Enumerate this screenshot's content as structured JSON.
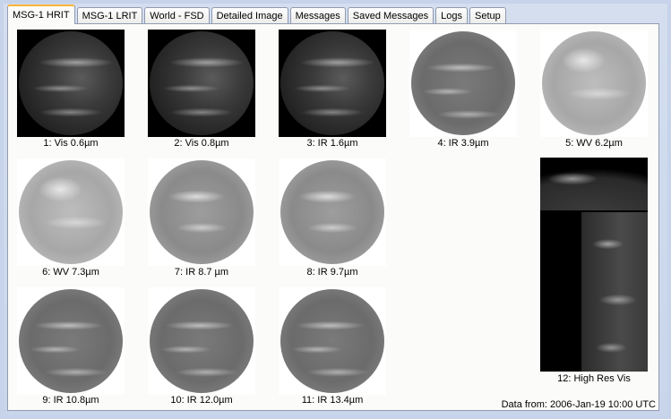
{
  "tabs": [
    {
      "label": "MSG-1 HRIT",
      "active": true
    },
    {
      "label": "MSG-1 LRIT"
    },
    {
      "label": "World - FSD"
    },
    {
      "label": "Detailed Image"
    },
    {
      "label": "Messages"
    },
    {
      "label": "Saved Messages"
    },
    {
      "label": "Logs"
    },
    {
      "label": "Setup"
    }
  ],
  "images": [
    {
      "label": "1:  Vis 0.6µm"
    },
    {
      "label": "2:  Vis 0.8µm"
    },
    {
      "label": "3:  IR 1.6µm"
    },
    {
      "label": "4:  IR 3.9µm"
    },
    {
      "label": "5:  WV 6.2µm"
    },
    {
      "label": "6:  WV 7.3µm"
    },
    {
      "label": "7:  IR 8.7 µm"
    },
    {
      "label": "8:  IR 9.7µm"
    },
    {
      "label": "9:  IR 10.8µm"
    },
    {
      "label": "10:  IR 12.0µm"
    },
    {
      "label": "11:  IR 13.4µm"
    },
    {
      "label": "12:  High Res Vis"
    }
  ],
  "status": {
    "data_from": "Data from:  2006-Jan-19   10:00 UTC"
  }
}
